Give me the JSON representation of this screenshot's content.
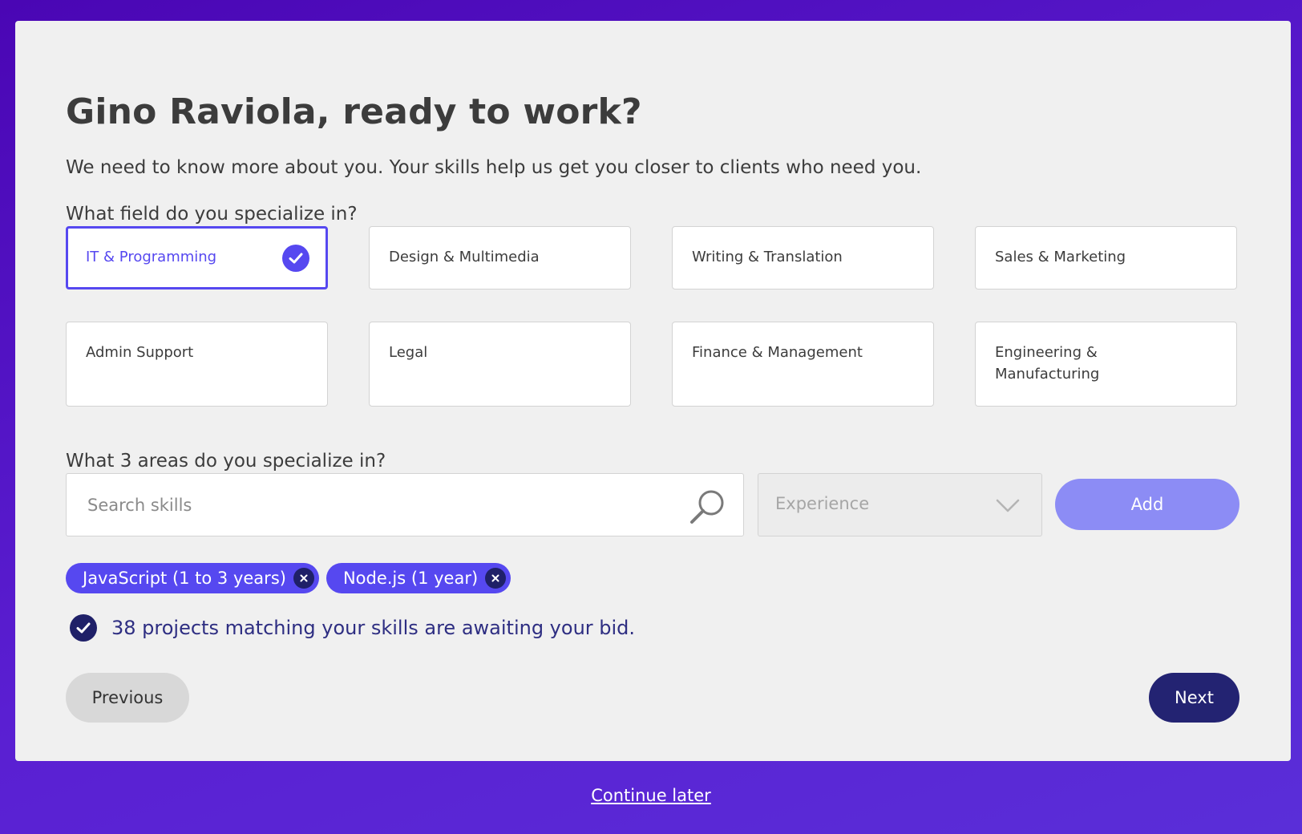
{
  "header": {
    "title": "Gino Raviola, ready to work?",
    "subtitle": "We need to know more about you. Your skills help us get you closer to clients who need you."
  },
  "fields": {
    "question": "What field do you specialize in?",
    "options": [
      {
        "label": "IT & Programming",
        "selected": true
      },
      {
        "label": "Design & Multimedia",
        "selected": false
      },
      {
        "label": "Writing & Translation",
        "selected": false
      },
      {
        "label": "Sales & Marketing",
        "selected": false
      },
      {
        "label": "Admin Support",
        "selected": false
      },
      {
        "label": "Legal",
        "selected": false
      },
      {
        "label": "Finance & Management",
        "selected": false
      },
      {
        "label": "Engineering & Manufacturing",
        "selected": false
      }
    ]
  },
  "skills": {
    "question": "What 3 areas do you specialize in?",
    "search": {
      "placeholder": "Search skills",
      "value": ""
    },
    "experience": {
      "placeholder": "Experience"
    },
    "add_label": "Add",
    "tags": [
      {
        "label": "JavaScript (1 to 3 years)"
      },
      {
        "label": "Node.js (1 year)"
      }
    ],
    "match_message": "38 projects matching your skills are awaiting your bid."
  },
  "nav": {
    "previous_label": "Previous",
    "next_label": "Next",
    "continue_later_label": "Continue later"
  },
  "colors": {
    "accent": "#5648f0",
    "dark_navy": "#232372",
    "add_button": "#8c8cf5",
    "background_gradient": [
      "#4a06b4",
      "#5a2ed8"
    ]
  },
  "icons": {
    "selected": "check-circle-icon",
    "search": "search-icon",
    "dropdown": "chevron-down-icon",
    "remove_tag": "close-icon",
    "match": "check-circle-icon"
  }
}
